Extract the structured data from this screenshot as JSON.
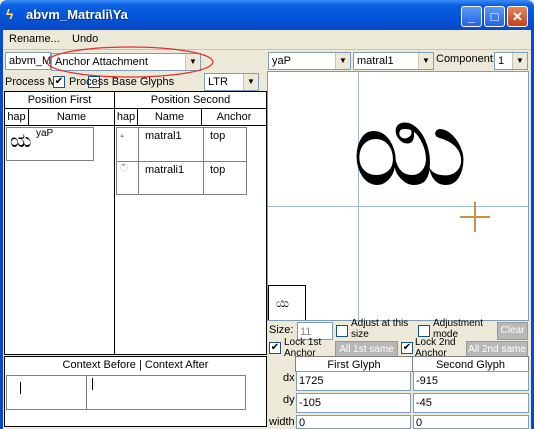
{
  "window": {
    "title": "abvm_Matrali\\Ya"
  },
  "menu": {
    "rename": "Rename...",
    "undo": "Undo"
  },
  "toolbar": {
    "feature_combo": "abvm_M",
    "lookup_type_combo": "Anchor Attachment",
    "process_label": "Process M",
    "process_base_label": "Process Base Glyphs",
    "direction_combo": "LTR",
    "first_glyph_combo": "yaP",
    "second_glyph_combo": "matral1",
    "component_label": "Component:",
    "component_combo": "1"
  },
  "position_first": {
    "title": "Position First",
    "col_shape": "hap",
    "col_name": "Name",
    "rows": [
      {
        "glyph": "ಯ",
        "name": "yaP"
      }
    ]
  },
  "position_second": {
    "title": "Position Second",
    "col_shape": "hap",
    "col_name": "Name",
    "col_anchor": "Anchor",
    "rows": [
      {
        "glyph": "ಀ",
        "name": "matral1",
        "anchor": "top"
      },
      {
        "glyph": "ಁ",
        "name": "matrali1",
        "anchor": "top"
      }
    ]
  },
  "preview": {
    "glyph": "ಯಿ",
    "thumb": "ಯಿ"
  },
  "preview_controls": {
    "size_label": "Size:",
    "size_value": "11",
    "adjust_label": "Adjust at this size",
    "adjust_mode_label": "Adjustment mode",
    "clear_button": "Clear",
    "lock1_label": "Lock 1st Anchor",
    "all1_button": "All 1st same",
    "lock2_label": "Lock 2nd Anchor",
    "all2_button": "All 2nd same"
  },
  "context": {
    "title": "Context Before | Context After"
  },
  "values_table": {
    "col_first": "First Glyph",
    "col_second": "Second Glyph",
    "rows": [
      {
        "label": "dx",
        "first": "1725",
        "second": "-915"
      },
      {
        "label": "dy",
        "first": "-105",
        "second": "-45"
      },
      {
        "label": "width",
        "first": "0",
        "second": "0"
      }
    ]
  },
  "colors": {
    "titlebar": "#0553d8",
    "highlight_oval": "#e03030",
    "guide_line": "#9fb8d8",
    "anchor_cross": "#c89048"
  }
}
